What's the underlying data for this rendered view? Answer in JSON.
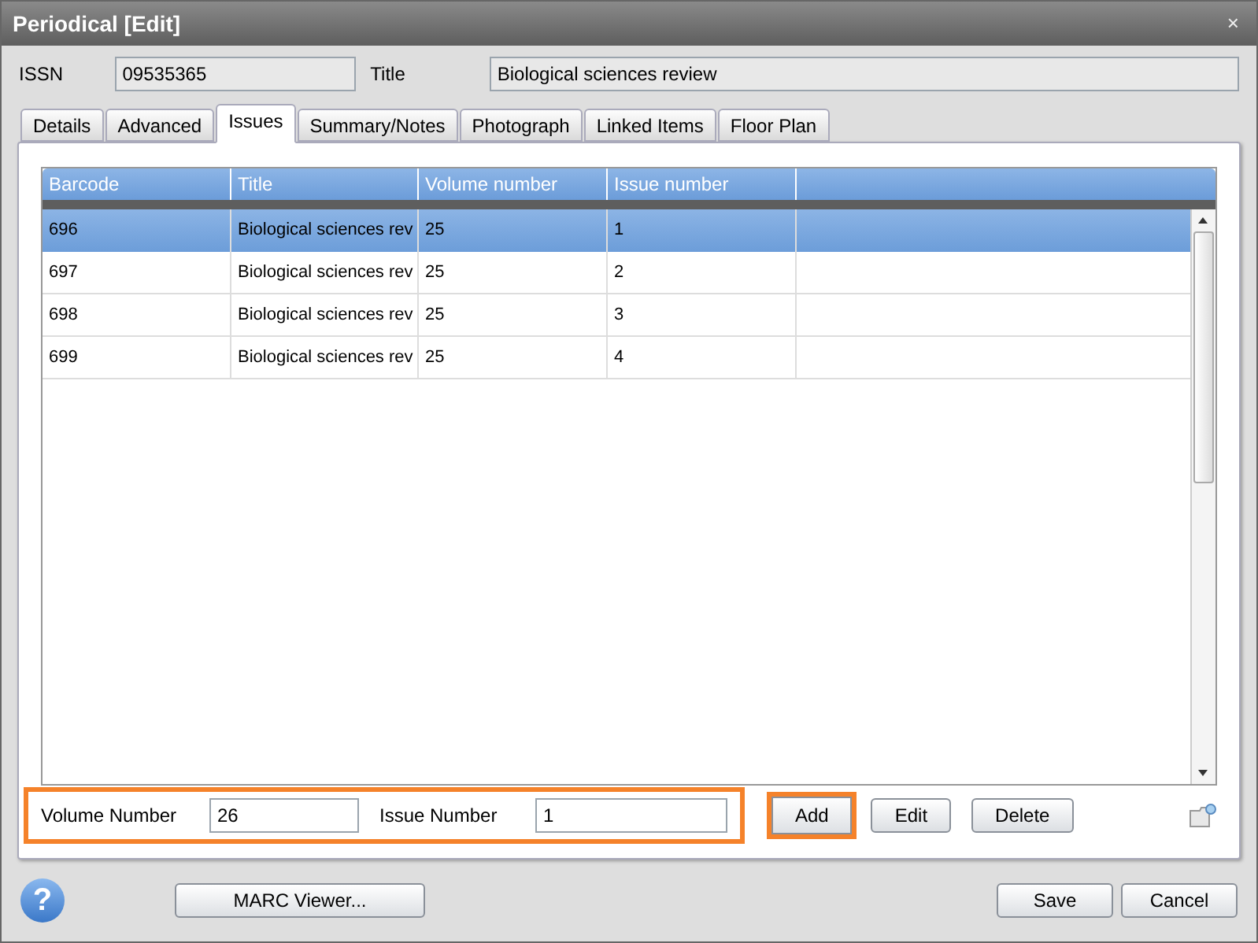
{
  "window": {
    "title": "Periodical [Edit]",
    "close": "×"
  },
  "header": {
    "issn_label": "ISSN",
    "issn": "09535365",
    "title_label": "Title",
    "title": "Biological sciences review"
  },
  "tabs": [
    {
      "label": "Details",
      "selected": false
    },
    {
      "label": "Advanced",
      "selected": false
    },
    {
      "label": "Issues",
      "selected": true
    },
    {
      "label": "Summary/Notes",
      "selected": false
    },
    {
      "label": "Photograph",
      "selected": false
    },
    {
      "label": "Linked Items",
      "selected": false
    },
    {
      "label": "Floor Plan",
      "selected": false
    }
  ],
  "table": {
    "columns": [
      "Barcode",
      "Title",
      "Volume number",
      "Issue number"
    ],
    "rows": [
      {
        "cells": [
          "696",
          "Biological sciences rev",
          "25",
          "1"
        ],
        "selected": true
      },
      {
        "cells": [
          "697",
          "Biological sciences rev",
          "25",
          "2"
        ],
        "selected": false
      },
      {
        "cells": [
          "698",
          "Biological sciences rev",
          "25",
          "3"
        ],
        "selected": false
      },
      {
        "cells": [
          "699",
          "Biological sciences rev",
          "25",
          "4"
        ],
        "selected": false
      }
    ]
  },
  "issue_form": {
    "highlighted": true,
    "volume_label": "Volume Number",
    "volume": "26",
    "issue_label": "Issue Number",
    "issue": "1"
  },
  "actions": [
    {
      "label": "Add",
      "highlighted": true
    },
    {
      "label": "Edit",
      "highlighted": false
    },
    {
      "label": "Delete",
      "highlighted": false
    }
  ],
  "footer": {
    "help": "?",
    "buttons": [
      "MARC Viewer...",
      "Save",
      "Cancel"
    ]
  }
}
